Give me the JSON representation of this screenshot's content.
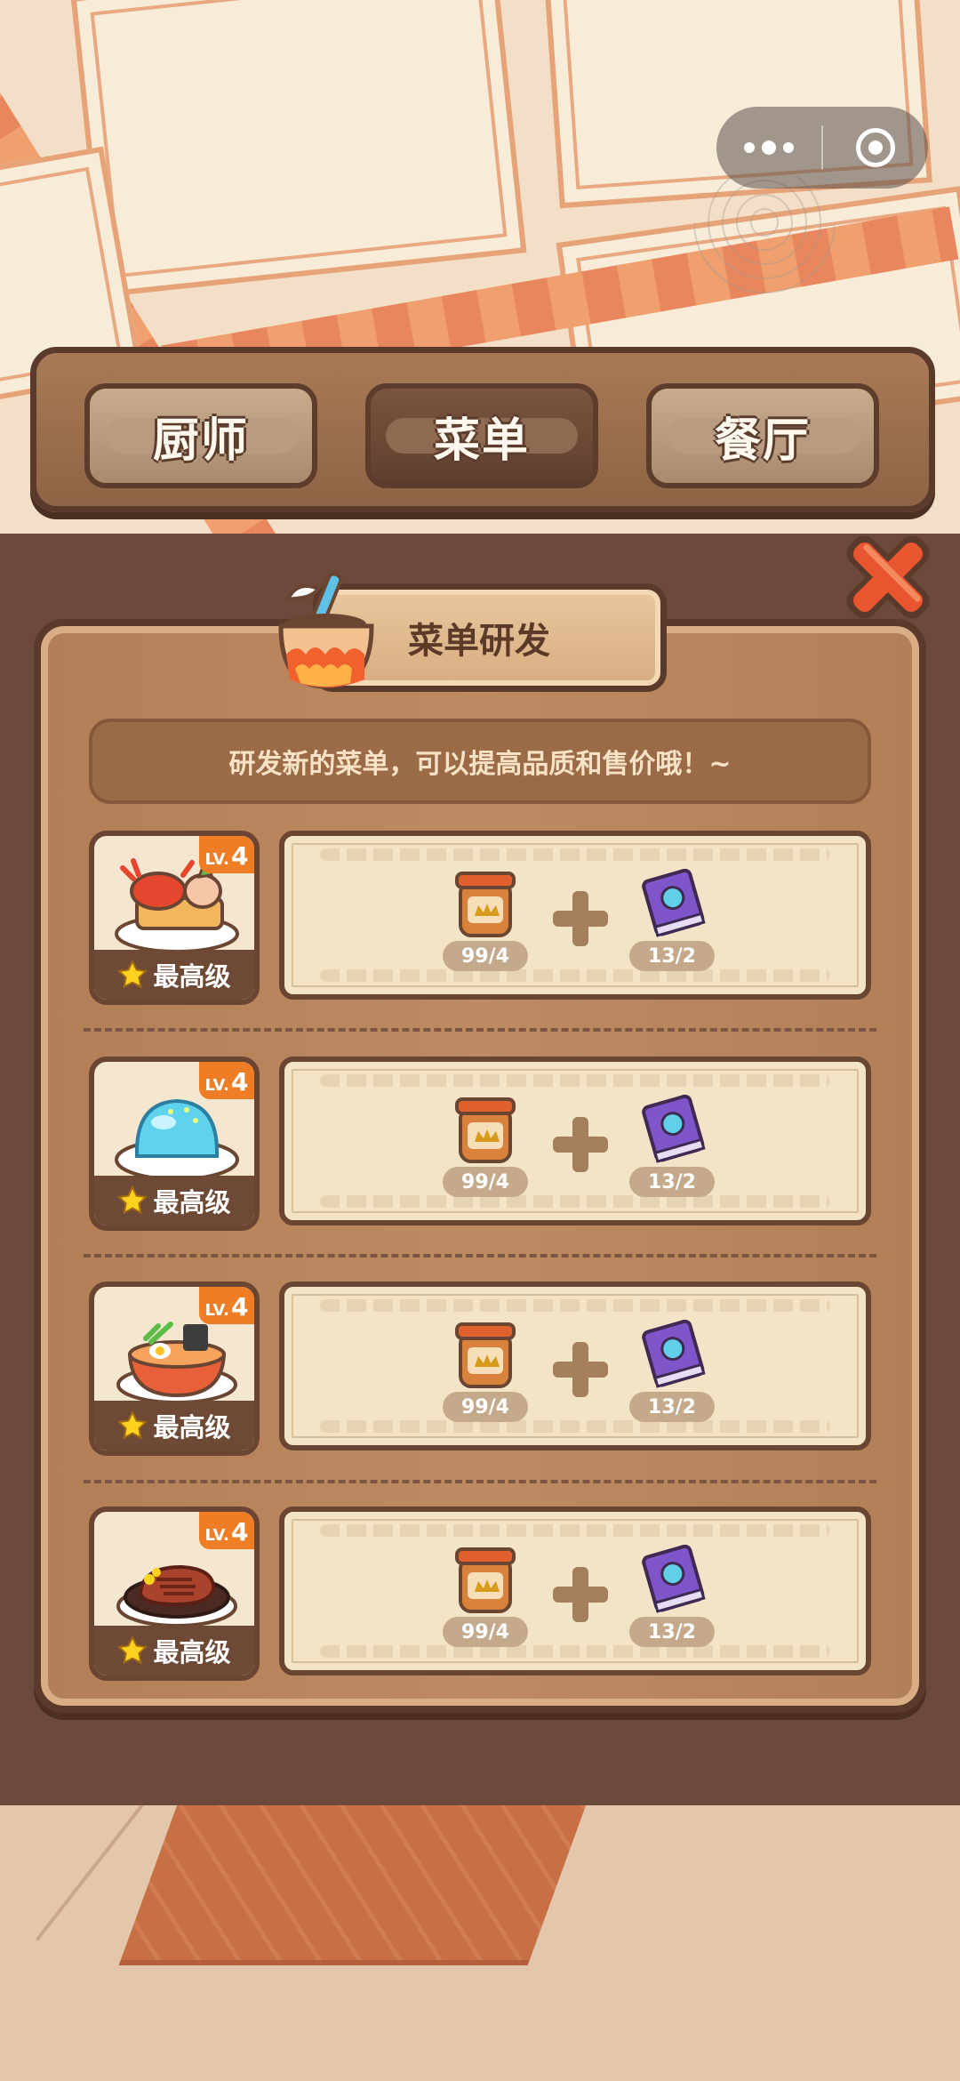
{
  "capsule": {
    "more_icon": "more-dots-icon",
    "close_icon": "target-close-icon"
  },
  "tabs": [
    {
      "label": "厨师",
      "active": false
    },
    {
      "label": "菜单",
      "active": true
    },
    {
      "label": "餐厅",
      "active": false
    }
  ],
  "panel": {
    "title": "菜单研发",
    "tip": "研发新的菜单，可以提高品质和售价哦！~"
  },
  "dishes": [
    {
      "food": "seafood-platter",
      "level_prefix": "LV.",
      "level": "4",
      "grade": "最高级",
      "material_a": "99/4",
      "material_b": "13/2"
    },
    {
      "food": "blue-jelly",
      "level_prefix": "LV.",
      "level": "4",
      "grade": "最高级",
      "material_a": "99/4",
      "material_b": "13/2"
    },
    {
      "food": "ramen-bowl",
      "level_prefix": "LV.",
      "level": "4",
      "grade": "最高级",
      "material_a": "99/4",
      "material_b": "13/2"
    },
    {
      "food": "steak-plate",
      "level_prefix": "LV.",
      "level": "4",
      "grade": "最高级",
      "material_a": "99/4",
      "material_b": "13/2"
    }
  ],
  "colors": {
    "accent_orange": "#ee7d25",
    "wood_dark": "#5a3a2a",
    "close_red": "#e8552f"
  }
}
